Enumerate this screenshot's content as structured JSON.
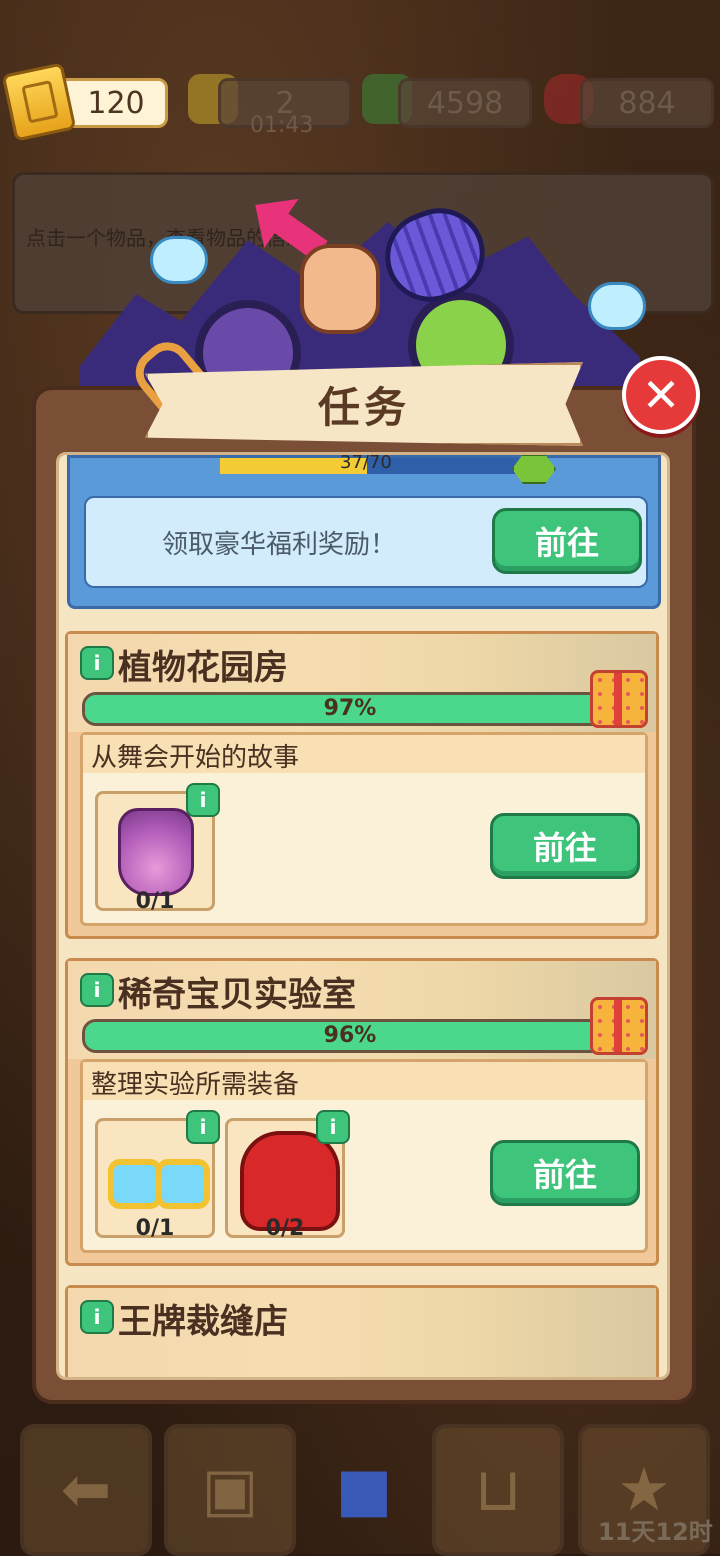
{
  "currency": {
    "tickets": "120",
    "energy": "2",
    "energy_timer": "01:43",
    "cash": "4598",
    "gems": "884"
  },
  "hint_text": "点击一个物品，查看物品的信息",
  "modal": {
    "title": "任务",
    "reward_progress": "37/70",
    "reward_progress_fraction": 0.53,
    "reward_text": "领取豪华福利奖励！",
    "go_label": "前往",
    "tasks": [
      {
        "name": "植物花园房",
        "progress_text": "97%",
        "progress": 0.97,
        "sub_title": "从舞会开始的故事",
        "items": [
          {
            "icon": "perfume-bottle-icon",
            "count": "0/1"
          }
        ]
      },
      {
        "name": "稀奇宝贝实验室",
        "progress_text": "96%",
        "progress": 0.96,
        "sub_title": "整理实验所需装备",
        "items": [
          {
            "icon": "sunglasses-icon",
            "count": "0/1"
          },
          {
            "icon": "red-gloves-icon",
            "count": "0/2"
          }
        ]
      },
      {
        "name": "王牌裁缝店"
      }
    ]
  },
  "bottom": {
    "season_timer": "11天12时"
  },
  "colors": {
    "go_button": "#3fc47c",
    "progress": "#4bd88c",
    "close": "#e63a3a"
  }
}
